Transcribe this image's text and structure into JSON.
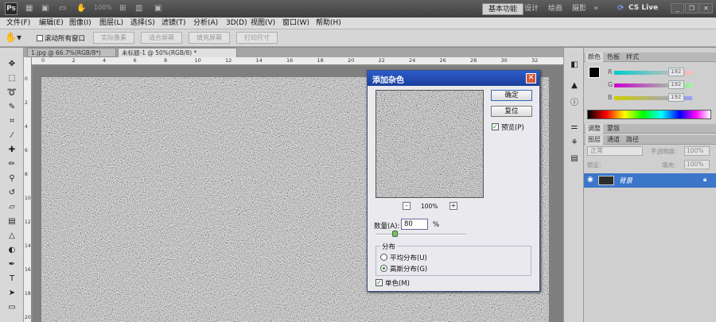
{
  "app": {
    "logo": "Ps",
    "zoom_display": "100%"
  },
  "workspaces": [
    "基本功能",
    "设计",
    "绘画",
    "摄影"
  ],
  "cs_live": "CS Live",
  "menu": [
    "文件(F)",
    "编辑(E)",
    "图像(I)",
    "图层(L)",
    "选择(S)",
    "滤镜(T)",
    "分析(A)",
    "3D(D)",
    "视图(V)",
    "窗口(W)",
    "帮助(H)"
  ],
  "options": {
    "scroll_all_windows": "滚动所有窗口",
    "buttons": [
      "实际像素",
      "适合屏幕",
      "填充屏幕",
      "打印尺寸"
    ]
  },
  "document_tabs": [
    "1.jpg @ 66.7%(RGB/8*)",
    "未标题-1 @ 50%(RGB/8) *"
  ],
  "ruler_top_numbers": [
    "0",
    "2",
    "4",
    "6",
    "8",
    "10",
    "12",
    "14",
    "16",
    "18",
    "20",
    "22",
    "24",
    "26",
    "28",
    "30",
    "32"
  ],
  "ruler_left_numbers": [
    "0",
    "2",
    "4",
    "6",
    "8",
    "10",
    "12",
    "14",
    "16",
    "18",
    "20"
  ],
  "panels": {
    "color_tabs": [
      "颜色",
      "色板",
      "样式"
    ],
    "color_values": [
      "192",
      "192",
      "192"
    ],
    "adjust_tabs": [
      "调整",
      "蒙版"
    ],
    "layer_tabs": [
      "图层",
      "通道",
      "路径"
    ],
    "blend_mode": "正常",
    "opacity_label": "不透明度:",
    "opacity_value": "100%",
    "lock_label": "锁定:",
    "fill_label": "填充:",
    "fill_value": "100%",
    "layer_name": "背景"
  },
  "dialog": {
    "title": "添加杂色",
    "ok": "确定",
    "reset": "复位",
    "preview": "预览(P)",
    "zoom": "100%",
    "zoom_out": "-",
    "zoom_in": "+",
    "amount_label": "数量(A):",
    "amount_value": "80",
    "amount_unit": "%",
    "amount_level": 0.22,
    "distribution_title": "分布",
    "uniform": "平均分布(U)",
    "gaussian": "高斯分布(G)",
    "monochromatic": "单色(M)"
  }
}
